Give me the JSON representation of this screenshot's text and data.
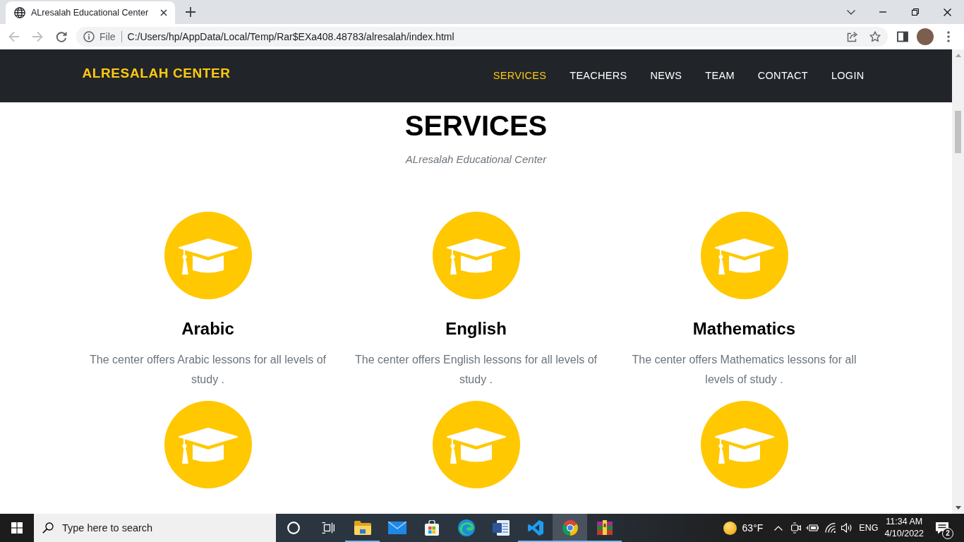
{
  "browser": {
    "tab": {
      "title": "ALresalah Educational Center"
    },
    "address_bar": {
      "scheme": "File",
      "url": "C:/Users/hp/AppData/Local/Temp/Rar$EXa408.48783/alresalah/index.html"
    }
  },
  "navbar": {
    "brand": "ALRESALAH CENTER",
    "links": [
      {
        "label": "SERVICES",
        "selected": true
      },
      {
        "label": "TEACHERS",
        "selected": false
      },
      {
        "label": "NEWS",
        "selected": false
      },
      {
        "label": "TEAM",
        "selected": false
      },
      {
        "label": "CONTACT",
        "selected": false
      },
      {
        "label": "LOGIN",
        "selected": false
      }
    ]
  },
  "services": {
    "title": "SERVICES",
    "subtitle": "ALresalah Educational Center",
    "items": [
      {
        "kind": "full",
        "name": "Arabic",
        "description": "The center offers Arabic lessons for all levels of study ."
      },
      {
        "kind": "full",
        "name": "English",
        "description": "The center offers English lessons for all levels of study ."
      },
      {
        "kind": "full",
        "name": "Mathematics",
        "description": "The center offers Mathematics lessons for all levels of study ."
      },
      {
        "kind": "cut_off"
      },
      {
        "kind": "cut_off"
      },
      {
        "kind": "cut_off"
      }
    ]
  },
  "taskbar": {
    "search": {
      "placeholder": "Type here to search"
    },
    "apps": [
      {
        "running": true,
        "selected": false
      },
      {
        "running": false,
        "selected": false
      },
      {
        "running": false,
        "selected": false
      },
      {
        "running": false,
        "selected": false
      },
      {
        "running": false,
        "selected": false
      },
      {
        "running": true,
        "selected": false
      },
      {
        "running": true,
        "selected": true
      },
      {
        "running": true,
        "selected": false
      }
    ],
    "weather": "63°F",
    "language": "ENG",
    "time": "11:34 AM",
    "date": "4/10/2022",
    "notifications": "2"
  }
}
